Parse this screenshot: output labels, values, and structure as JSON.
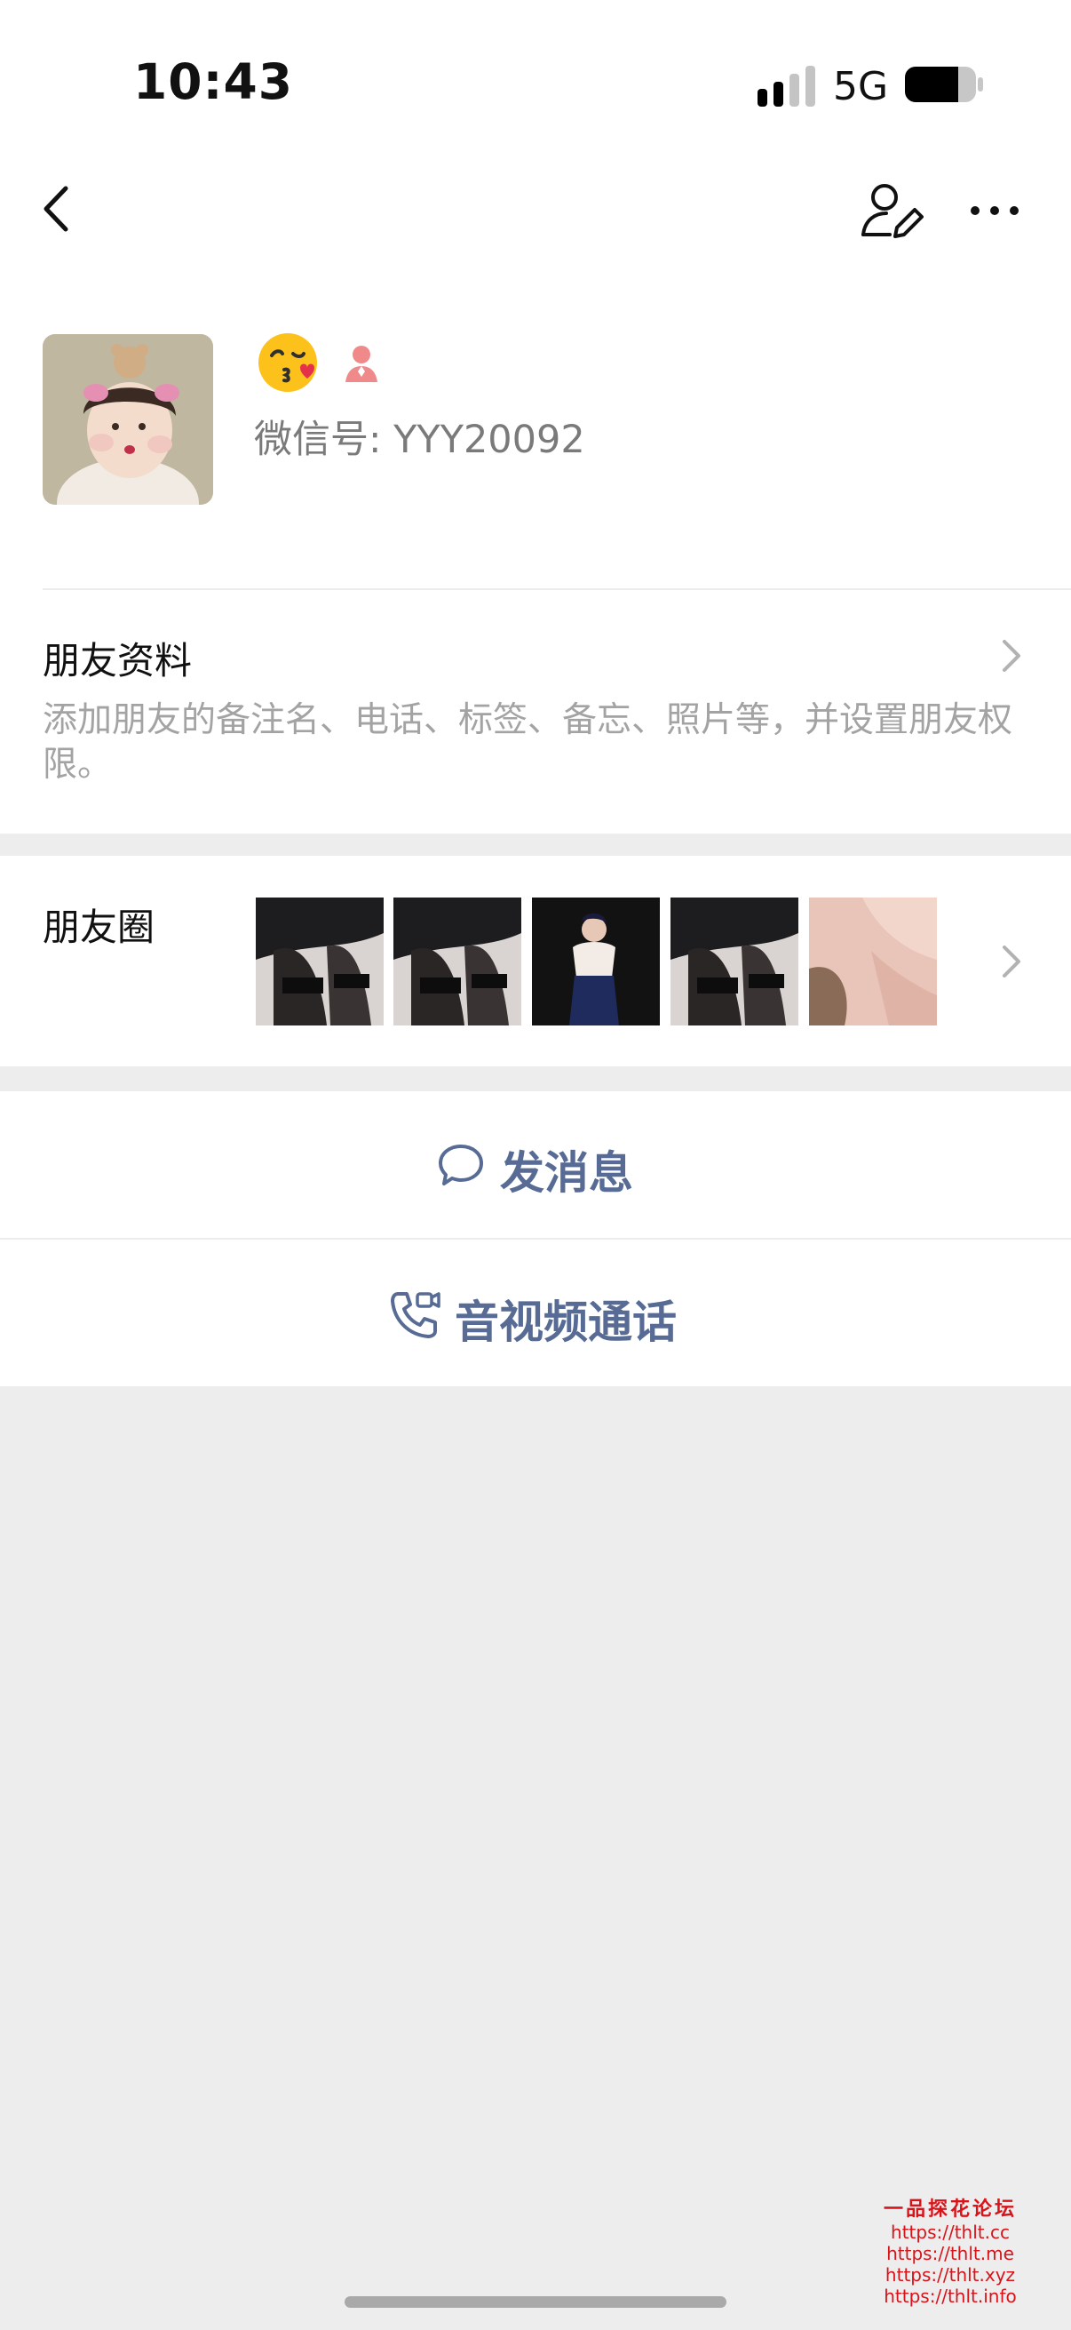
{
  "status_bar": {
    "time": "10:43",
    "network": "5G",
    "battery_level": 0.75
  },
  "header": {
    "back_icon": "chevron-left-icon",
    "edit_icon": "user-edit-icon",
    "more_icon": "more-horizontal-icon"
  },
  "profile": {
    "name_emoji": "kissing-face-emoji",
    "gender_icon": "female-icon",
    "gender_color": "#f08a8a",
    "wechat_id": "微信号: YYY20092"
  },
  "friend_profile": {
    "title": "朋友资料",
    "description": "添加朋友的备注名、电话、标签、备忘、照片等，并设置朋友权限。"
  },
  "moments": {
    "title": "朋友圈",
    "thumbnails": [
      "moment-photo-1",
      "moment-photo-2",
      "moment-photo-3",
      "moment-photo-4",
      "moment-photo-5"
    ]
  },
  "actions": {
    "send_message": "发消息",
    "video_call": "音视频通话",
    "accent_color": "#576b95"
  },
  "watermark": {
    "title": "一品探花论坛",
    "links": [
      "https://thlt.cc",
      "https://thlt.me",
      "https://thlt.xyz",
      "https://thlt.info"
    ]
  }
}
